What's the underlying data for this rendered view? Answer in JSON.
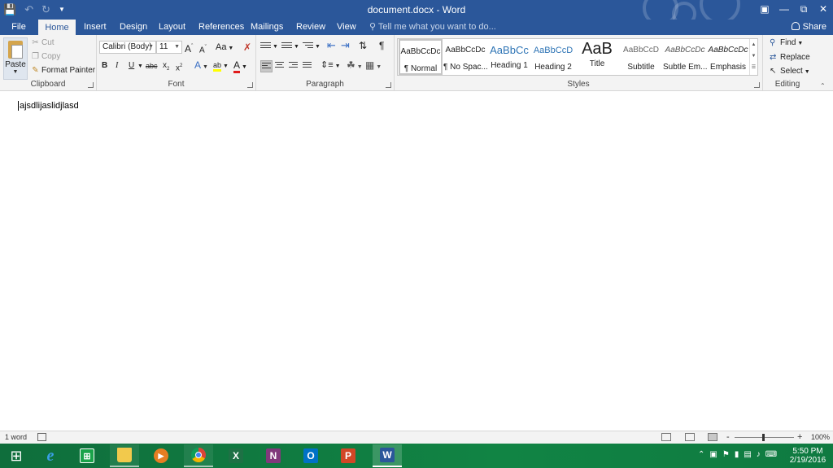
{
  "titlebar": {
    "title": "document.docx - Word",
    "qat_icons": [
      "save-icon",
      "undo-icon",
      "redo-icon",
      "customize-qat-icon"
    ],
    "window_controls": [
      "ribbon-display-icon",
      "minimize-icon",
      "restore-icon",
      "close-icon"
    ]
  },
  "tabs": {
    "file": "File",
    "home": "Home",
    "insert": "Insert",
    "design": "Design",
    "layout": "Layout",
    "references": "References",
    "mailings": "Mailings",
    "review": "Review",
    "view": "View",
    "tell_me": "Tell me what you want to do...",
    "share": "Share"
  },
  "clipboard": {
    "paste": "Paste",
    "cut": "Cut",
    "copy": "Copy",
    "format_painter": "Format Painter",
    "label": "Clipboard"
  },
  "font": {
    "name": "Calibri (Body)",
    "size": "11",
    "grow": "A",
    "shrink": "A",
    "change_case": "Aa",
    "bold": "B",
    "italic": "I",
    "underline": "U",
    "strikethrough": "abc",
    "subscript": "x",
    "superscript": "x",
    "text_effects": "A",
    "highlight": "ab",
    "font_color": "A",
    "label": "Font"
  },
  "paragraph": {
    "show_marks": "¶",
    "label": "Paragraph"
  },
  "styles": {
    "items": [
      {
        "preview": "AaBbCcDc",
        "name": "¶ Normal"
      },
      {
        "preview": "AaBbCcDc",
        "name": "¶ No Spac..."
      },
      {
        "preview": "AaBbCc",
        "name": "Heading 1"
      },
      {
        "preview": "AaBbCcD",
        "name": "Heading 2"
      },
      {
        "preview": "AaB",
        "name": "Title"
      },
      {
        "preview": "AaBbCcD",
        "name": "Subtitle"
      },
      {
        "preview": "AaBbCcDc",
        "name": "Subtle Em..."
      },
      {
        "preview": "AaBbCcDc",
        "name": "Emphasis"
      }
    ],
    "label": "Styles"
  },
  "editing": {
    "find": "Find",
    "replace": "Replace",
    "select": "Select",
    "label": "Editing"
  },
  "document": {
    "text": "ajsdlijaslidjlasd"
  },
  "status": {
    "word_count": "1 word",
    "zoom_minus": "-",
    "zoom_plus": "+",
    "zoom_percent": "100%",
    "zoom_level": 1.0
  },
  "taskbar": {
    "apps": [
      {
        "name": "start",
        "glyph": "⊞"
      },
      {
        "name": "internet-explorer",
        "glyph": "e"
      },
      {
        "name": "store",
        "glyph": "⊞"
      },
      {
        "name": "file-explorer",
        "glyph": "▭"
      },
      {
        "name": "media-player",
        "glyph": "▶"
      },
      {
        "name": "chrome",
        "glyph": "◉"
      },
      {
        "name": "excel",
        "glyph": "X"
      },
      {
        "name": "onenote",
        "glyph": "N"
      },
      {
        "name": "outlook",
        "glyph": "O"
      },
      {
        "name": "powerpoint",
        "glyph": "P"
      },
      {
        "name": "word",
        "glyph": "W"
      }
    ],
    "time": "5:50 PM",
    "date": "2/19/2016"
  },
  "colors": {
    "word_blue": "#2b579a",
    "ribbon_bg": "#f3f3f3",
    "taskbar_green": "#118444"
  }
}
